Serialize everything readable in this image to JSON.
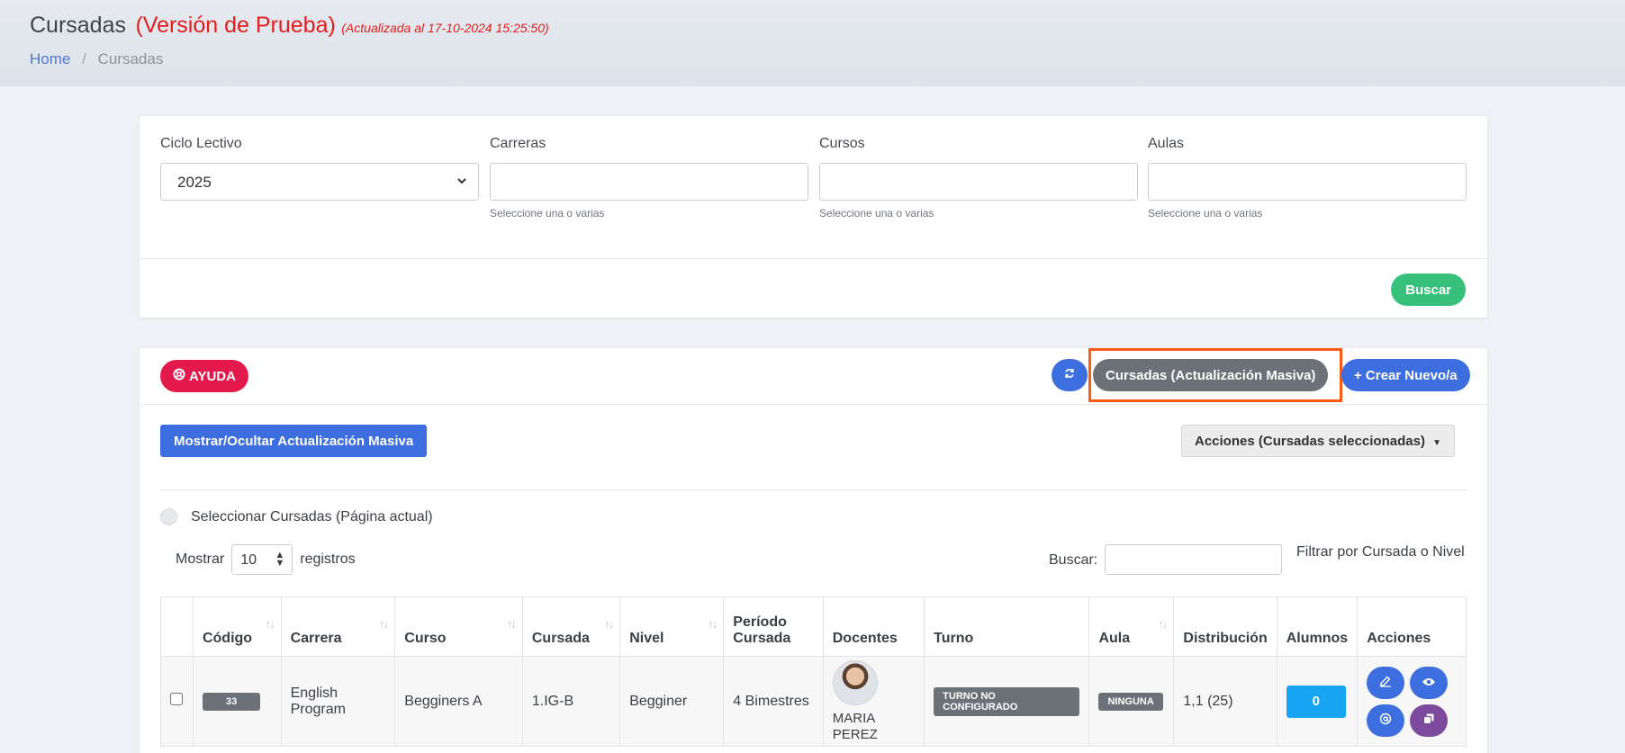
{
  "header": {
    "title": "Cursadas",
    "version": "(Versión de Prueba)",
    "updated": "(Actualizada al 17-10-2024 15:25:50)",
    "breadcrumb": {
      "home": "Home",
      "separator": "/",
      "current": "Cursadas"
    }
  },
  "filters": {
    "ciclo": {
      "label": "Ciclo Lectivo",
      "value": "2025"
    },
    "carreras": {
      "label": "Carreras",
      "hint": "Seleccione una o varias"
    },
    "cursos": {
      "label": "Cursos",
      "hint": "Seleccione una o varias"
    },
    "aulas": {
      "label": "Aulas",
      "hint": "Seleccione una o varias"
    },
    "buscar_button": "Buscar"
  },
  "toolbar": {
    "ayuda": "AYUDA",
    "masiva": "Cursadas (Actualización Masiva)",
    "crear": "+ Crear Nuevo/a",
    "mostrar_ocultar": "Mostrar/Ocultar Actualización Masiva",
    "acciones": "Acciones (Cursadas seleccionadas)",
    "highlight_color": "#ff5a14"
  },
  "selection": {
    "label": "Seleccionar Cursadas (Página actual)"
  },
  "datatable": {
    "mostrar": "Mostrar",
    "page_length": "10",
    "registros": "registros",
    "buscar": "Buscar:",
    "filtrar": "Filtrar por Cursada o Nivel"
  },
  "table": {
    "headers": {
      "codigo": "Código",
      "carrera": "Carrera",
      "curso": "Curso",
      "cursada": "Cursada",
      "nivel": "Nivel",
      "periodo_1": "Período",
      "periodo_2": "Cursada",
      "docentes": "Docentes",
      "turno": "Turno",
      "aula": "Aula",
      "distribucion": "Distribución",
      "alumnos": "Alumnos",
      "acciones": "Acciones"
    },
    "rows": [
      {
        "codigo": "33",
        "carrera_1": "English",
        "carrera_2": "Program",
        "curso": "Begginers A",
        "cursada": "1.IG-B",
        "nivel": "Begginer",
        "periodo": "4 Bimestres",
        "docente": "MARIA PEREZ",
        "turno": "TURNO NO CONFIGURADO",
        "aula": "NINGUNA",
        "distribucion": "1,1 (25)",
        "alumnos": "0"
      }
    ]
  },
  "colors": {
    "primary": "#3d6ee0",
    "success": "#37c07a",
    "danger": "#e3194b",
    "info": "#18a6f4",
    "secondary": "#6b7177",
    "purple": "#7d4a9e",
    "accent_red": "#e11d1d"
  }
}
